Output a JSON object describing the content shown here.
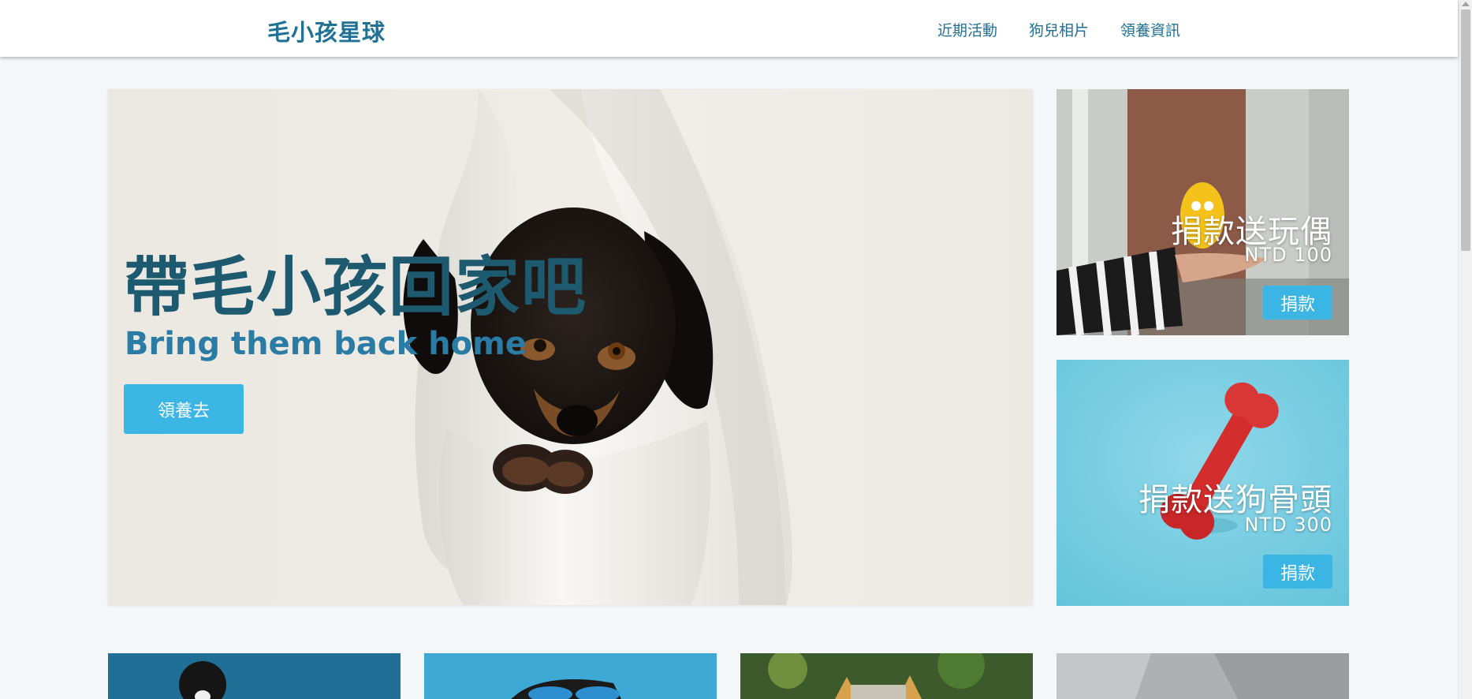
{
  "header": {
    "brand": "毛小孩星球",
    "nav": [
      "近期活動",
      "狗兒相片",
      "領養資訊"
    ]
  },
  "hero": {
    "title": "帶毛小孩回家吧",
    "subtitle": "Bring them back home",
    "button_label": "領養去"
  },
  "side_cards": [
    {
      "title": "捐款送玩偶",
      "price": "NTD 100",
      "button_label": "捐款"
    },
    {
      "title": "捐款送狗骨頭",
      "price": "NTD 300",
      "button_label": "捐款"
    }
  ],
  "colors": {
    "brand": "#217096",
    "hero_title": "#1d5a6f",
    "hero_subtitle": "#2a7ca4",
    "button": "#3bb6e4",
    "background": "#f4f6f8"
  },
  "icons": [
    "dachshund-photo",
    "toy-photo",
    "bone-photo",
    "dog-thumb-photos"
  ]
}
